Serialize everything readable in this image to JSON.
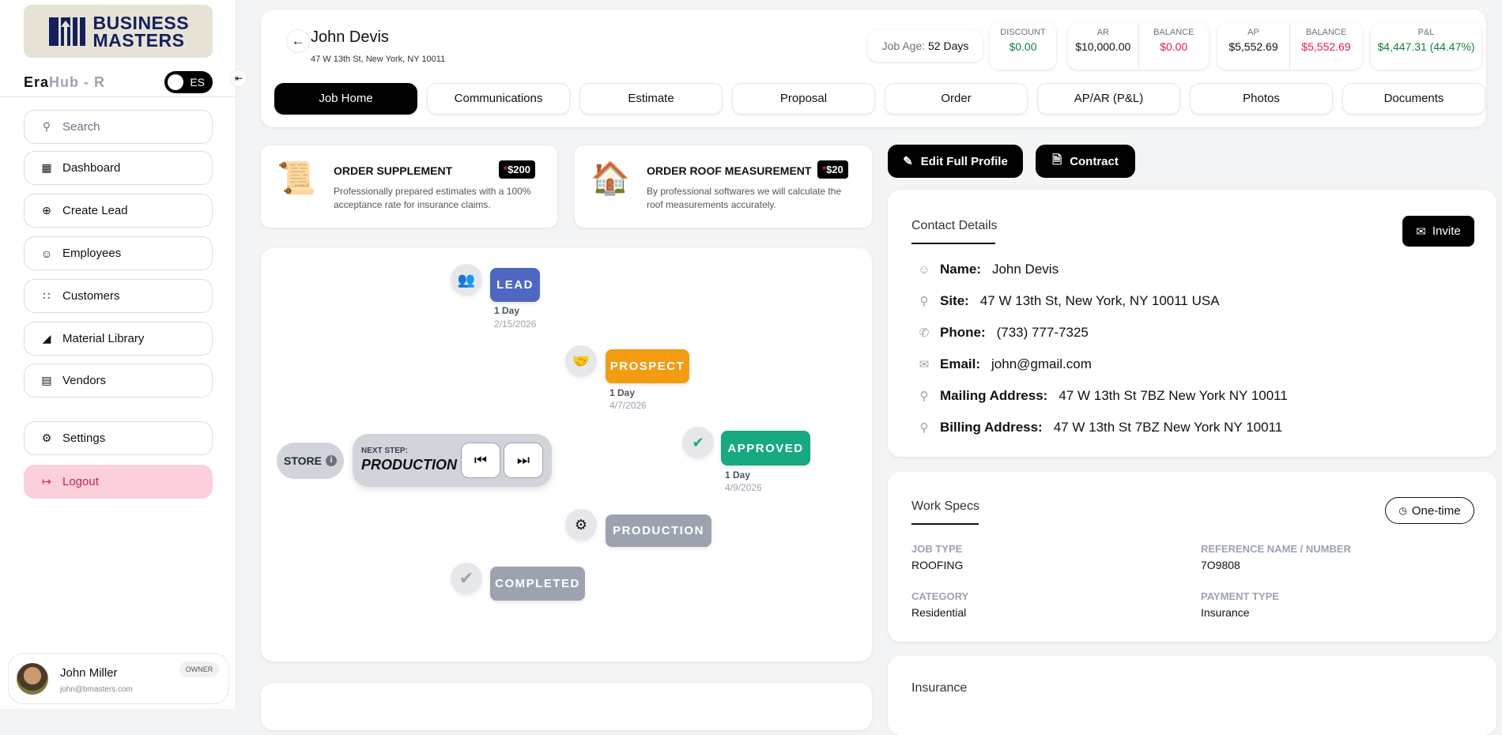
{
  "sidebar": {
    "logo": "BUSINESS MASTERS",
    "brand_era": "Era",
    "brand_hub": "Hub - R",
    "lang_toggle": "ES",
    "search_placeholder": "Search",
    "items": [
      {
        "label": "Dashboard",
        "icon": "dashboard-icon"
      },
      {
        "label": "Create Lead",
        "icon": "plus-circle-icon"
      },
      {
        "label": "Employees",
        "icon": "users-icon"
      },
      {
        "label": "Customers",
        "icon": "customers-icon"
      },
      {
        "label": "Material Library",
        "icon": "book-icon"
      },
      {
        "label": "Vendors",
        "icon": "warehouse-icon"
      }
    ],
    "settings": "Settings",
    "logout": "Logout",
    "user": {
      "name": "John Miller",
      "email": "john@bmasters.com",
      "role": "OWNER"
    }
  },
  "header": {
    "name": "John Devis",
    "address": "47 W 13th St, New York, NY 10011",
    "job_age_label": "Job Age:",
    "job_age": "52 Days",
    "discount": {
      "label": "DISCOUNT",
      "value": "$0.00"
    },
    "ar": {
      "label": "AR",
      "value": "$10,000.00",
      "balance_label": "BALANCE",
      "balance": "$0.00"
    },
    "ap": {
      "label": "AP",
      "value": "$5,552.69",
      "balance_label": "BALANCE",
      "balance": "$5,552.69"
    },
    "pl": {
      "label": "P&L",
      "value": "$4,447.31 (44.47%)"
    },
    "tabs": [
      "Job Home",
      "Communications",
      "Estimate",
      "Proposal",
      "Order",
      "AP/AR (P&L)",
      "Photos",
      "Documents"
    ],
    "active_tab": "Job Home"
  },
  "promos": [
    {
      "title": "ORDER SUPPLEMENT",
      "price": "$200",
      "desc": "Professionally prepared estimates with a 100% acceptance rate for insurance claims."
    },
    {
      "title": "ORDER ROOF MEASUREMENT",
      "price": "$20",
      "desc": "By professional softwares we will calculate the roof measurements accurately."
    }
  ],
  "timeline": {
    "stages": [
      {
        "label": "LEAD",
        "days": "1 Day",
        "date": "2/15/2026",
        "color": "#4f67c0"
      },
      {
        "label": "PROSPECT",
        "days": "1 Day",
        "date": "4/7/2026",
        "color": "#f39c12"
      },
      {
        "label": "APPROVED",
        "days": "1 Day",
        "date": "4/9/2026",
        "color": "#16a982"
      },
      {
        "label": "PRODUCTION",
        "color": "#9ca3af"
      },
      {
        "label": "COMPLETED",
        "color": "#9ca3af"
      }
    ],
    "store": "STORE",
    "next_step_label": "NEXT STEP:",
    "next_step": "PRODUCTION"
  },
  "actions": {
    "edit": "Edit Full Profile",
    "contract": "Contract"
  },
  "contact": {
    "title": "Contact Details",
    "invite": "Invite",
    "rows": [
      {
        "label": "Name:",
        "value": "John Devis"
      },
      {
        "label": "Site:",
        "value": "47 W 13th St, New York, NY 10011 USA"
      },
      {
        "label": "Phone:",
        "value": "(733) 777-7325"
      },
      {
        "label": "Email:",
        "value": "john@gmail.com"
      },
      {
        "label": "Mailing Address:",
        "value": "47 W 13th St 7BZ New York NY 10011"
      },
      {
        "label": "Billing Address:",
        "value": "47 W 13th St 7BZ New York NY 10011"
      }
    ]
  },
  "work_specs": {
    "title": "Work Specs",
    "frequency": "One-time",
    "job_type_label": "JOB TYPE",
    "job_type": "ROOFING",
    "ref_label": "REFERENCE NAME / NUMBER",
    "ref": "7O9808",
    "category_label": "CATEGORY",
    "category": "Residential",
    "payment_label": "PAYMENT TYPE",
    "payment": "Insurance"
  },
  "insurance": {
    "title": "Insurance"
  }
}
